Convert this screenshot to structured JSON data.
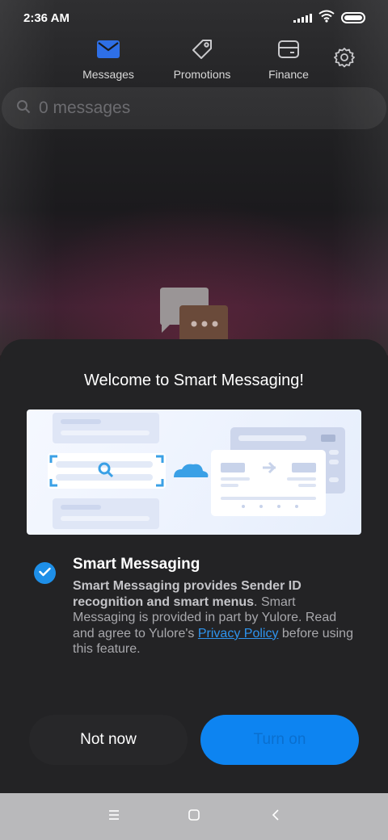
{
  "status_bar": {
    "time": "2:36 AM",
    "icons": [
      "signal-icon",
      "wifi-icon",
      "battery-icon"
    ]
  },
  "tabs": [
    {
      "label": "Messages",
      "icon": "envelope-icon",
      "active": true
    },
    {
      "label": "Promotions",
      "icon": "tag-icon",
      "active": false
    },
    {
      "label": "Finance",
      "icon": "wallet-icon",
      "active": false
    }
  ],
  "settings_icon": "gear-icon",
  "search": {
    "placeholder": "0 messages",
    "icon": "search-icon"
  },
  "dialog": {
    "title": "Welcome to Smart Messaging!",
    "option": {
      "checked": true,
      "title": "Smart Messaging",
      "desc_bold": "Smart Messaging provides Sender ID recognition and smart menus",
      "desc_part1": ". Smart Messaging is provided in part by Yulore. Read and agree to Yulore's ",
      "link": "Privacy Policy",
      "desc_part2": " before using this feature."
    },
    "buttons": {
      "not_now": "Not now",
      "turn_on": "Turn on"
    }
  },
  "nav_bar": {
    "icons": [
      "menu-icon",
      "home-icon",
      "back-icon"
    ]
  },
  "colors": {
    "accent": "#0d84f1",
    "tab_active": "#2e6fe6",
    "sheet": "#232325",
    "nav_bar": "#b9b9bb"
  }
}
